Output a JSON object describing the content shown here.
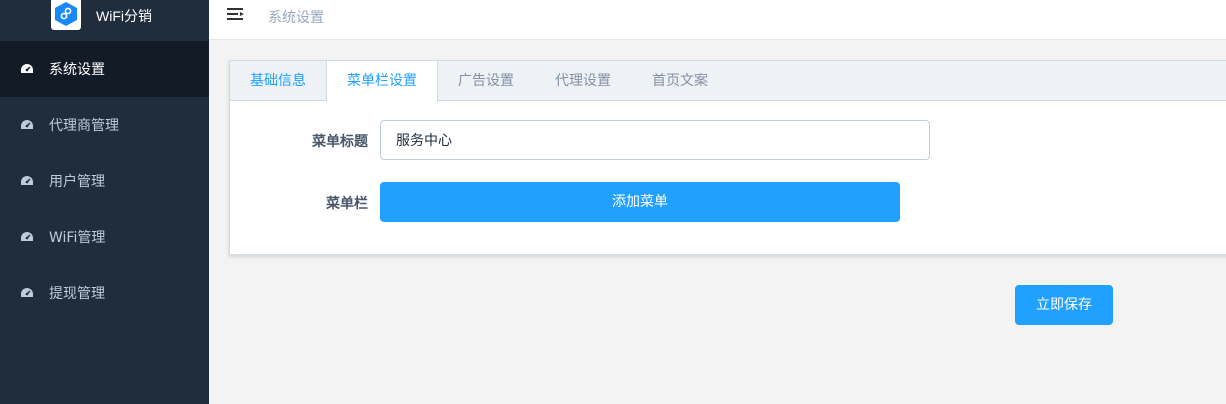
{
  "app": {
    "name": "WiFi分销",
    "logo_icon": "hexagon-link-icon"
  },
  "sidebar": {
    "items": [
      {
        "label": "系统设置",
        "icon": "dashboard-icon",
        "active": true
      },
      {
        "label": "代理商管理",
        "icon": "dashboard-icon",
        "active": false
      },
      {
        "label": "用户管理",
        "icon": "dashboard-icon",
        "active": false
      },
      {
        "label": "WiFi管理",
        "icon": "dashboard-icon",
        "active": false
      },
      {
        "label": "提现管理",
        "icon": "dashboard-icon",
        "active": false
      }
    ]
  },
  "header": {
    "breadcrumb": "系统设置",
    "menu_icon": "hamburger-icon"
  },
  "tabs": [
    {
      "label": "基础信息"
    },
    {
      "label": "菜单栏设置",
      "active": true
    },
    {
      "label": "广告设置"
    },
    {
      "label": "代理设置"
    },
    {
      "label": "首页文案"
    }
  ],
  "form": {
    "menu_title_label": "菜单标题",
    "menu_title_value": "服务中心",
    "menu_bar_label": "菜单栏",
    "add_menu_label": "添加菜单"
  },
  "actions": {
    "save_label": "立即保存"
  },
  "colors": {
    "primary": "#20a0ff",
    "sidebar_bg": "#1f2d3d",
    "sidebar_active_bg": "#131b26"
  }
}
